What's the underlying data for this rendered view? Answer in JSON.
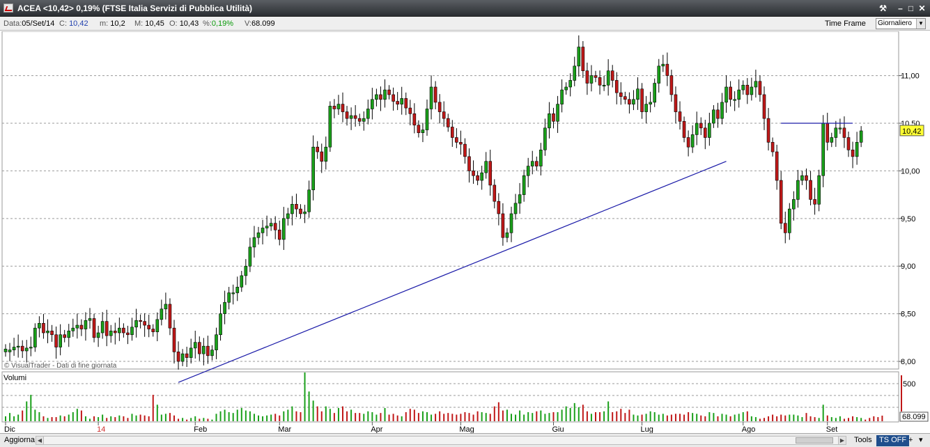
{
  "window": {
    "title": "ACEA <10,42> 0,19%  (FTSE Italia Servizi di Pubblica Utilità)"
  },
  "infobar": {
    "data_label": "Data:",
    "data_value": "05/Set/14",
    "c_label": "C:",
    "c_value": "10,42",
    "m_label": "m:",
    "m_value": "10,2",
    "M_label": "M:",
    "M_value": "10,45",
    "o_label": "O:",
    "o_value": "10,43",
    "pct_label": "%:",
    "pct_value": "0,19%",
    "v_label": "V:",
    "v_value": "68.099",
    "timeframe_label": "Time Frame",
    "timeframe_value": "Giornaliero"
  },
  "chart_data": {
    "type": "candlestick",
    "price_axis": {
      "ylim": [
        7.92,
        11.45
      ],
      "ticks": [
        8.0,
        8.5,
        9.0,
        9.5,
        10.0,
        10.5,
        11.0
      ],
      "tick_labels": [
        "8,00",
        "8,50",
        "9,00",
        "9,50",
        "10,00",
        "10,50",
        "11,00"
      ]
    },
    "last_price_label": "10,42",
    "last_price": 10.42,
    "x_labels": [
      "Dic",
      "14",
      "Feb",
      "Mar",
      "Apr",
      "Mag",
      "Giu",
      "Lug",
      "Ago",
      "Set"
    ],
    "x_label_index": [
      0,
      22,
      45,
      65,
      87,
      108,
      130,
      151,
      175,
      195
    ],
    "year_label_color": "#d03030",
    "watermark": "© VisualTrader - Dati di fine giornata",
    "volume_panel_label": "Volumi",
    "volume_axis_labels": [
      "500",
      "68.099"
    ],
    "volume_max": 590,
    "trendline": {
      "from": [
        41,
        7.78
      ],
      "to": [
        171,
        10.1
      ],
      "color": "#1a1aa8"
    },
    "resistance_line": {
      "from": [
        184,
        10.5
      ],
      "to": [
        201,
        10.5
      ],
      "color": "#1a1aa8"
    },
    "up_color": "#1aa01a",
    "down_color": "#c01818",
    "close": [
      8.13,
      8.12,
      8.15,
      8.16,
      8.11,
      8.14,
      8.15,
      8.35,
      8.4,
      8.3,
      8.32,
      8.28,
      8.15,
      8.28,
      8.25,
      8.32,
      8.35,
      8.38,
      8.34,
      8.43,
      8.45,
      8.25,
      8.3,
      8.42,
      8.27,
      8.32,
      8.3,
      8.35,
      8.3,
      8.28,
      8.36,
      8.43,
      8.42,
      8.38,
      8.34,
      8.31,
      8.44,
      8.55,
      8.6,
      8.35,
      8.1,
      8.0,
      8.08,
      8.04,
      8.14,
      8.2,
      8.08,
      8.16,
      8.06,
      8.12,
      8.28,
      8.5,
      8.62,
      8.72,
      8.72,
      8.78,
      8.9,
      9.0,
      9.2,
      9.3,
      9.35,
      9.4,
      9.42,
      9.45,
      9.38,
      9.28,
      9.5,
      9.55,
      9.65,
      9.6,
      9.55,
      9.57,
      9.8,
      10.25,
      10.2,
      10.1,
      10.25,
      10.68,
      10.65,
      10.7,
      10.62,
      10.55,
      10.58,
      10.55,
      10.52,
      10.55,
      10.65,
      10.75,
      10.8,
      10.75,
      10.85,
      10.8,
      10.73,
      10.7,
      10.76,
      10.66,
      10.6,
      10.48,
      10.4,
      10.43,
      10.65,
      10.88,
      10.72,
      10.62,
      10.55,
      10.46,
      10.35,
      10.3,
      10.28,
      10.15,
      10.0,
      9.95,
      9.9,
      9.98,
      10.1,
      9.85,
      9.68,
      9.55,
      9.3,
      9.35,
      9.55,
      9.66,
      9.75,
      9.95,
      10.05,
      10.1,
      10.05,
      10.22,
      10.45,
      10.6,
      10.52,
      10.7,
      10.85,
      10.88,
      10.95,
      11.1,
      11.3,
      11.05,
      10.92,
      11.0,
      10.98,
      10.9,
      10.9,
      11.05,
      10.95,
      10.82,
      10.78,
      10.75,
      10.7,
      10.75,
      10.86,
      10.62,
      10.7,
      10.72,
      10.92,
      11.1,
      11.12,
      11.0,
      10.8,
      10.62,
      10.52,
      10.35,
      10.25,
      10.38,
      10.5,
      10.45,
      10.35,
      10.5,
      10.64,
      10.55,
      10.72,
      10.88,
      10.75,
      10.75,
      10.85,
      10.9,
      10.8,
      10.88,
      10.94,
      10.8,
      10.55,
      10.3,
      10.2,
      9.9,
      9.45,
      9.35,
      9.6,
      9.7,
      9.9,
      9.95,
      9.9,
      9.7,
      9.65,
      9.95,
      10.5,
      10.3,
      10.35,
      10.45,
      10.45,
      10.35,
      10.22,
      10.15,
      10.3,
      10.42
    ],
    "open": [
      8.1,
      8.1,
      8.12,
      8.15,
      8.16,
      8.11,
      8.14,
      8.15,
      8.35,
      8.4,
      8.3,
      8.32,
      8.28,
      8.15,
      8.28,
      8.25,
      8.32,
      8.35,
      8.38,
      8.34,
      8.43,
      8.45,
      8.25,
      8.3,
      8.42,
      8.27,
      8.32,
      8.3,
      8.35,
      8.3,
      8.28,
      8.36,
      8.43,
      8.42,
      8.38,
      8.34,
      8.31,
      8.44,
      8.55,
      8.6,
      8.35,
      8.1,
      8.0,
      8.08,
      8.04,
      8.14,
      8.2,
      8.08,
      8.16,
      8.06,
      8.12,
      8.28,
      8.5,
      8.62,
      8.72,
      8.72,
      8.78,
      8.9,
      9.0,
      9.2,
      9.3,
      9.35,
      9.4,
      9.42,
      9.45,
      9.38,
      9.28,
      9.5,
      9.55,
      9.65,
      9.6,
      9.55,
      9.57,
      9.8,
      10.25,
      10.2,
      10.1,
      10.25,
      10.68,
      10.65,
      10.7,
      10.62,
      10.55,
      10.58,
      10.55,
      10.52,
      10.55,
      10.65,
      10.75,
      10.8,
      10.75,
      10.85,
      10.8,
      10.73,
      10.7,
      10.76,
      10.66,
      10.6,
      10.48,
      10.4,
      10.43,
      10.65,
      10.88,
      10.72,
      10.62,
      10.55,
      10.46,
      10.35,
      10.3,
      10.28,
      10.15,
      10.0,
      9.95,
      9.9,
      9.98,
      10.1,
      9.85,
      9.68,
      9.55,
      9.3,
      9.35,
      9.55,
      9.66,
      9.75,
      9.95,
      10.05,
      10.1,
      10.05,
      10.22,
      10.45,
      10.6,
      10.52,
      10.7,
      10.85,
      10.88,
      10.95,
      11.1,
      11.3,
      11.05,
      10.92,
      11.0,
      10.98,
      10.9,
      10.9,
      11.05,
      10.95,
      10.82,
      10.78,
      10.75,
      10.7,
      10.75,
      10.86,
      10.62,
      10.7,
      10.72,
      10.92,
      11.1,
      11.12,
      11.0,
      10.8,
      10.62,
      10.52,
      10.35,
      10.25,
      10.38,
      10.5,
      10.45,
      10.35,
      10.5,
      10.64,
      10.55,
      10.72,
      10.88,
      10.75,
      10.75,
      10.85,
      10.9,
      10.8,
      10.88,
      10.94,
      10.8,
      10.55,
      10.3,
      10.2,
      9.9,
      9.45,
      9.35,
      9.6,
      9.7,
      9.9,
      9.95,
      9.9,
      9.7,
      9.65,
      9.95,
      10.5,
      10.3,
      10.35,
      10.45,
      10.45,
      10.35,
      10.22,
      10.15,
      10.3,
      10.43
    ],
    "volume": [
      60,
      100,
      60,
      80,
      130,
      240,
      320,
      140,
      110,
      60,
      40,
      50,
      50,
      70,
      60,
      80,
      110,
      150,
      130,
      60,
      30,
      60,
      50,
      80,
      40,
      60,
      50,
      70,
      60,
      40,
      90,
      70,
      80,
      70,
      60,
      320,
      200,
      80,
      90,
      100,
      70,
      30,
      40,
      20,
      40,
      60,
      30,
      40,
      30,
      20,
      90,
      120,
      140,
      110,
      100,
      140,
      160,
      130,
      120,
      90,
      70,
      60,
      70,
      80,
      90,
      70,
      120,
      140,
      180,
      120,
      110,
      590,
      360,
      250,
      180,
      120,
      180,
      150,
      100,
      160,
      180,
      120,
      140,
      100,
      100,
      90,
      120,
      110,
      80,
      100,
      160,
      80,
      90,
      70,
      60,
      110,
      150,
      140,
      100,
      120,
      110,
      80,
      90,
      120,
      90,
      100,
      90,
      80,
      90,
      110,
      100,
      80,
      120,
      110,
      100,
      90,
      180,
      230,
      130,
      140,
      90,
      80,
      130,
      80,
      110,
      100,
      120,
      130,
      90,
      100,
      110,
      110,
      140,
      180,
      160,
      220,
      170,
      200,
      120,
      90,
      110,
      110,
      120,
      240,
      110,
      120,
      150,
      100,
      140,
      80,
      70,
      80,
      90,
      120,
      110,
      80,
      90,
      70,
      80,
      90,
      90,
      80,
      110,
      100,
      90,
      70,
      60,
      110,
      100,
      60,
      90,
      80,
      60,
      80,
      90,
      110,
      120,
      60,
      50,
      30,
      40,
      60,
      80,
      60,
      80,
      70,
      80,
      80,
      70,
      50,
      100,
      60,
      50,
      40,
      200,
      70,
      50,
      40,
      60,
      30,
      40,
      60,
      50,
      40,
      20,
      40,
      60,
      50,
      68
    ]
  },
  "bottombar": {
    "aggiorna_label": "Aggiorna",
    "tools_label": "Tools",
    "tsoff_label": "TS OFF",
    "plus_label": "+",
    "menu_label": "▾"
  }
}
